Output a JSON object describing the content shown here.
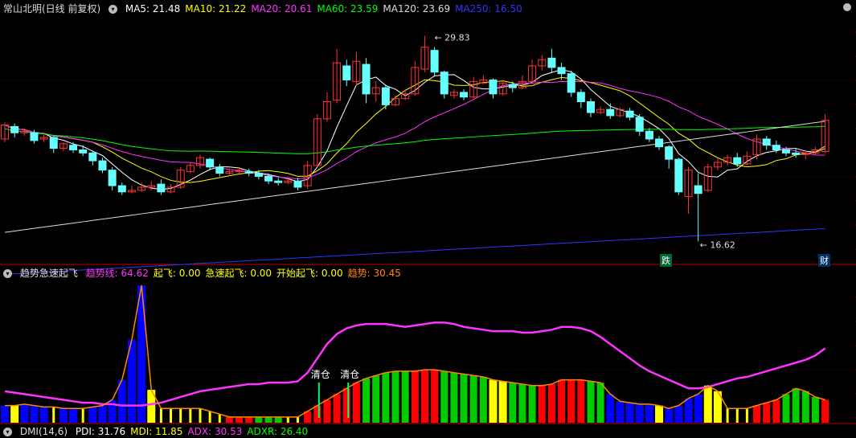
{
  "main_panel": {
    "title": "常山北明(日线 前复权)",
    "ma_legend": [
      {
        "label": "MA5: 21.48",
        "color": "#ffffff"
      },
      {
        "label": "MA10: 21.22",
        "color": "#ffff00"
      },
      {
        "label": "MA20: 20.61",
        "color": "#ff33ff"
      },
      {
        "label": "MA60: 23.59",
        "color": "#00ff00"
      },
      {
        "label": "MA120: 23.69",
        "color": "#dddddd"
      },
      {
        "label": "MA250: 16.50",
        "color": "#3333ff"
      }
    ],
    "high_label": "29.83",
    "low_label": "16.62",
    "badge_left": "跌",
    "badge_right": "财"
  },
  "indicator_panel": {
    "title": "趋势急速起飞",
    "legend": [
      {
        "label": "趋势线: 64.62",
        "color": "#ff33ff"
      },
      {
        "label": "起飞: 0.00",
        "color": "#ffff00"
      },
      {
        "label": "急速起飞: 0.00",
        "color": "#ffff00"
      },
      {
        "label": "开始起飞: 0.00",
        "color": "#ffff00"
      },
      {
        "label": "趋势: 30.45",
        "color": "#ff8800"
      }
    ],
    "annotations": [
      "清仓",
      "清仓"
    ]
  },
  "bottom_panel": {
    "title": "DMI(14,6)",
    "legend": [
      {
        "label": "PDI: 31.76",
        "color": "#ffffff"
      },
      {
        "label": "MDI: 11.85",
        "color": "#ffff00"
      },
      {
        "label": "ADX: 30.53",
        "color": "#ff33ff"
      },
      {
        "label": "ADXR: 26.40",
        "color": "#00ff00"
      }
    ]
  },
  "chart_data": {
    "type": "candlestick",
    "y_range": [
      15.5,
      31.0
    ],
    "candles": [
      [
        23.2,
        24.1,
        24.3,
        23.0
      ],
      [
        24.0,
        23.6,
        24.2,
        23.3
      ],
      [
        23.6,
        23.7,
        23.9,
        23.4
      ],
      [
        23.6,
        23.1,
        23.8,
        22.9
      ],
      [
        23.2,
        23.3,
        23.5,
        23.0
      ],
      [
        23.3,
        22.6,
        23.4,
        22.3
      ],
      [
        22.6,
        22.9,
        23.0,
        22.4
      ],
      [
        22.8,
        22.5,
        23.0,
        22.3
      ],
      [
        22.5,
        22.3,
        22.8,
        22.1
      ],
      [
        22.3,
        21.8,
        22.4,
        21.5
      ],
      [
        21.8,
        21.2,
        22.0,
        21.0
      ],
      [
        21.2,
        20.2,
        21.4,
        19.9
      ],
      [
        20.2,
        19.8,
        20.4,
        19.6
      ],
      [
        19.8,
        19.9,
        20.2,
        19.7
      ],
      [
        19.9,
        20.1,
        20.4,
        19.8
      ],
      [
        20.1,
        20.2,
        20.5,
        19.9
      ],
      [
        20.3,
        19.8,
        20.6,
        19.6
      ],
      [
        19.8,
        20.1,
        20.3,
        19.7
      ],
      [
        20.1,
        21.2,
        21.4,
        20.0
      ],
      [
        21.1,
        21.5,
        21.7,
        21.0
      ],
      [
        21.5,
        22.0,
        22.2,
        21.3
      ],
      [
        21.9,
        21.4,
        22.0,
        21.2
      ],
      [
        21.4,
        21.0,
        21.6,
        20.8
      ],
      [
        21.0,
        21.1,
        21.3,
        20.8
      ],
      [
        21.1,
        21.2,
        21.4,
        21.0
      ],
      [
        21.1,
        21.0,
        21.3,
        20.8
      ],
      [
        21.0,
        20.8,
        21.2,
        20.6
      ],
      [
        20.8,
        20.5,
        21.0,
        20.3
      ],
      [
        20.5,
        20.4,
        20.7,
        20.2
      ],
      [
        20.4,
        20.5,
        20.8,
        20.3
      ],
      [
        20.5,
        20.1,
        20.7,
        19.9
      ],
      [
        20.2,
        21.5,
        21.8,
        20.0
      ],
      [
        21.5,
        24.5,
        24.8,
        21.4
      ],
      [
        24.5,
        25.6,
        26.2,
        24.3
      ],
      [
        25.7,
        28.1,
        29.0,
        25.5
      ],
      [
        27.9,
        27.0,
        28.3,
        26.6
      ],
      [
        26.9,
        28.2,
        28.8,
        26.6
      ],
      [
        28.0,
        26.1,
        28.4,
        25.5
      ],
      [
        26.1,
        26.5,
        26.9,
        25.6
      ],
      [
        26.5,
        25.4,
        26.7,
        25.1
      ],
      [
        25.4,
        25.8,
        26.0,
        25.3
      ],
      [
        25.8,
        26.1,
        26.4,
        25.7
      ],
      [
        26.1,
        27.8,
        28.2,
        26.0
      ],
      [
        27.7,
        29.1,
        29.83,
        27.5
      ],
      [
        28.9,
        27.5,
        29.1,
        27.2
      ],
      [
        27.5,
        26.1,
        27.6,
        25.8
      ],
      [
        26.0,
        26.2,
        26.4,
        25.8
      ],
      [
        26.2,
        25.9,
        26.4,
        25.7
      ],
      [
        25.9,
        26.9,
        27.2,
        25.8
      ],
      [
        26.8,
        27.0,
        27.3,
        26.7
      ],
      [
        27.0,
        26.1,
        27.1,
        25.8
      ],
      [
        26.1,
        26.8,
        27.0,
        26.0
      ],
      [
        26.7,
        26.5,
        26.9,
        26.2
      ],
      [
        26.5,
        26.9,
        27.3,
        26.4
      ],
      [
        26.9,
        27.9,
        28.3,
        26.8
      ],
      [
        27.9,
        28.3,
        28.6,
        27.6
      ],
      [
        28.4,
        27.8,
        29.0,
        27.5
      ],
      [
        27.8,
        27.4,
        28.1,
        27.0
      ],
      [
        27.4,
        26.2,
        27.6,
        25.9
      ],
      [
        26.2,
        25.6,
        26.4,
        25.2
      ],
      [
        25.6,
        24.9,
        25.8,
        24.6
      ],
      [
        24.9,
        25.1,
        25.3,
        24.8
      ],
      [
        25.1,
        24.7,
        25.5,
        24.5
      ],
      [
        24.7,
        25.1,
        25.2,
        24.6
      ],
      [
        25.0,
        24.6,
        25.2,
        24.4
      ],
      [
        24.6,
        23.7,
        24.8,
        23.4
      ],
      [
        23.7,
        23.2,
        23.9,
        23.0
      ],
      [
        23.2,
        22.7,
        23.4,
        22.5
      ],
      [
        22.7,
        21.9,
        22.8,
        21.3
      ],
      [
        21.9,
        19.8,
        22.0,
        19.6
      ],
      [
        19.5,
        21.2,
        21.4,
        18.4
      ],
      [
        20.2,
        19.7,
        21.0,
        16.62
      ],
      [
        19.9,
        21.4,
        21.6,
        19.8
      ],
      [
        21.4,
        21.7,
        22.0,
        21.2
      ],
      [
        21.7,
        22.0,
        22.2,
        21.5
      ],
      [
        22.0,
        21.6,
        22.3,
        21.4
      ],
      [
        21.6,
        22.1,
        22.4,
        21.5
      ],
      [
        22.2,
        23.2,
        23.5,
        21.9
      ],
      [
        23.2,
        22.8,
        23.4,
        22.5
      ],
      [
        22.8,
        22.5,
        23.1,
        22.3
      ],
      [
        22.5,
        22.3,
        22.7,
        22.1
      ],
      [
        22.3,
        22.2,
        22.6,
        22.0
      ],
      [
        22.2,
        22.3,
        22.5,
        21.9
      ],
      [
        22.3,
        22.5,
        22.7,
        22.2
      ],
      [
        22.4,
        24.4,
        24.8,
        22.3
      ]
    ],
    "indicator": {
      "y_range": [
        0,
        100
      ],
      "trend_line": [
        22,
        21,
        20,
        19,
        18,
        17,
        16,
        15,
        14,
        14,
        13,
        13,
        12,
        12,
        12,
        13,
        14,
        16,
        18,
        20,
        22,
        23,
        24,
        25,
        26,
        27,
        27,
        28,
        28,
        28,
        29,
        35,
        45,
        55,
        62,
        66,
        68,
        69,
        69,
        69,
        68,
        67,
        68,
        69,
        70,
        70,
        69,
        67,
        66,
        65,
        64,
        64,
        64,
        63,
        63,
        64,
        65,
        67,
        67,
        66,
        64,
        60,
        55,
        50,
        45,
        40,
        36,
        33,
        30,
        27,
        24,
        24,
        25,
        27,
        29,
        31,
        32,
        34,
        36,
        38,
        40,
        42,
        44,
        47,
        52
      ],
      "bars": [
        12,
        12,
        13,
        12,
        11,
        11,
        10,
        10,
        10,
        11,
        12,
        16,
        30,
        58,
        96,
        23,
        10,
        10,
        10,
        10,
        10,
        8,
        6,
        4,
        4,
        4,
        4,
        4,
        4,
        4,
        4,
        8,
        12,
        16,
        20,
        24,
        28,
        31,
        33,
        35,
        36,
        36,
        36,
        37,
        37,
        36,
        35,
        34,
        33,
        32,
        30,
        29,
        28,
        27,
        26,
        26,
        27,
        30,
        30,
        30,
        29,
        28,
        20,
        15,
        14,
        13,
        13,
        12,
        10,
        12,
        17,
        20,
        26,
        22,
        10,
        10,
        10,
        12,
        14,
        16,
        20,
        24,
        22,
        18,
        16
      ],
      "bar_colors": [
        "b",
        "y",
        "b",
        "b",
        "b",
        "y",
        "b",
        "b",
        "y",
        "b",
        "b",
        "b",
        "b",
        "b",
        "b",
        "y",
        "y",
        "y",
        "y",
        "y",
        "y",
        "y",
        "y",
        "r",
        "r",
        "r",
        "g",
        "g",
        "g",
        "y",
        "y",
        "r",
        "r",
        "r",
        "r",
        "r",
        "r",
        "g",
        "g",
        "g",
        "g",
        "g",
        "r",
        "r",
        "r",
        "g",
        "g",
        "g",
        "g",
        "g",
        "y",
        "y",
        "g",
        "g",
        "g",
        "r",
        "r",
        "r",
        "r",
        "r",
        "g",
        "g",
        "b",
        "b",
        "b",
        "b",
        "b",
        "y",
        "b",
        "b",
        "b",
        "b",
        "y",
        "y",
        "y",
        "y",
        "y",
        "r",
        "r",
        "r",
        "g",
        "g",
        "g",
        "g",
        "r"
      ]
    }
  }
}
